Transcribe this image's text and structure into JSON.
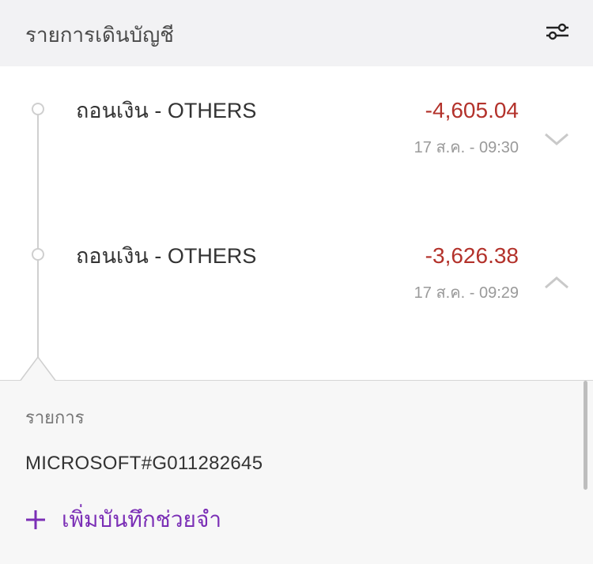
{
  "header": {
    "title": "รายการเดินบัญชี",
    "filter_icon": "sliders-icon"
  },
  "transactions": [
    {
      "title": "ถอนเงิน - OTHERS",
      "amount": "-4,605.04",
      "date": "17 ส.ค. - 09:30",
      "expanded": false,
      "chevron": "chevron-down-icon"
    },
    {
      "title": "ถอนเงิน - OTHERS",
      "amount": "-3,626.38",
      "date": "17 ส.ค. - 09:29",
      "expanded": true,
      "chevron": "chevron-up-icon"
    }
  ],
  "detail": {
    "label": "รายการ",
    "value": "MICROSOFT#G011282645",
    "add_note_label": "เพิ่มบันทึกช่วยจำ",
    "add_icon": "plus-icon"
  },
  "colors": {
    "amount_negative": "#b3322b",
    "accent": "#7b2fb6",
    "header_bg": "#f2f2f4",
    "panel_bg": "#f7f7f7"
  }
}
